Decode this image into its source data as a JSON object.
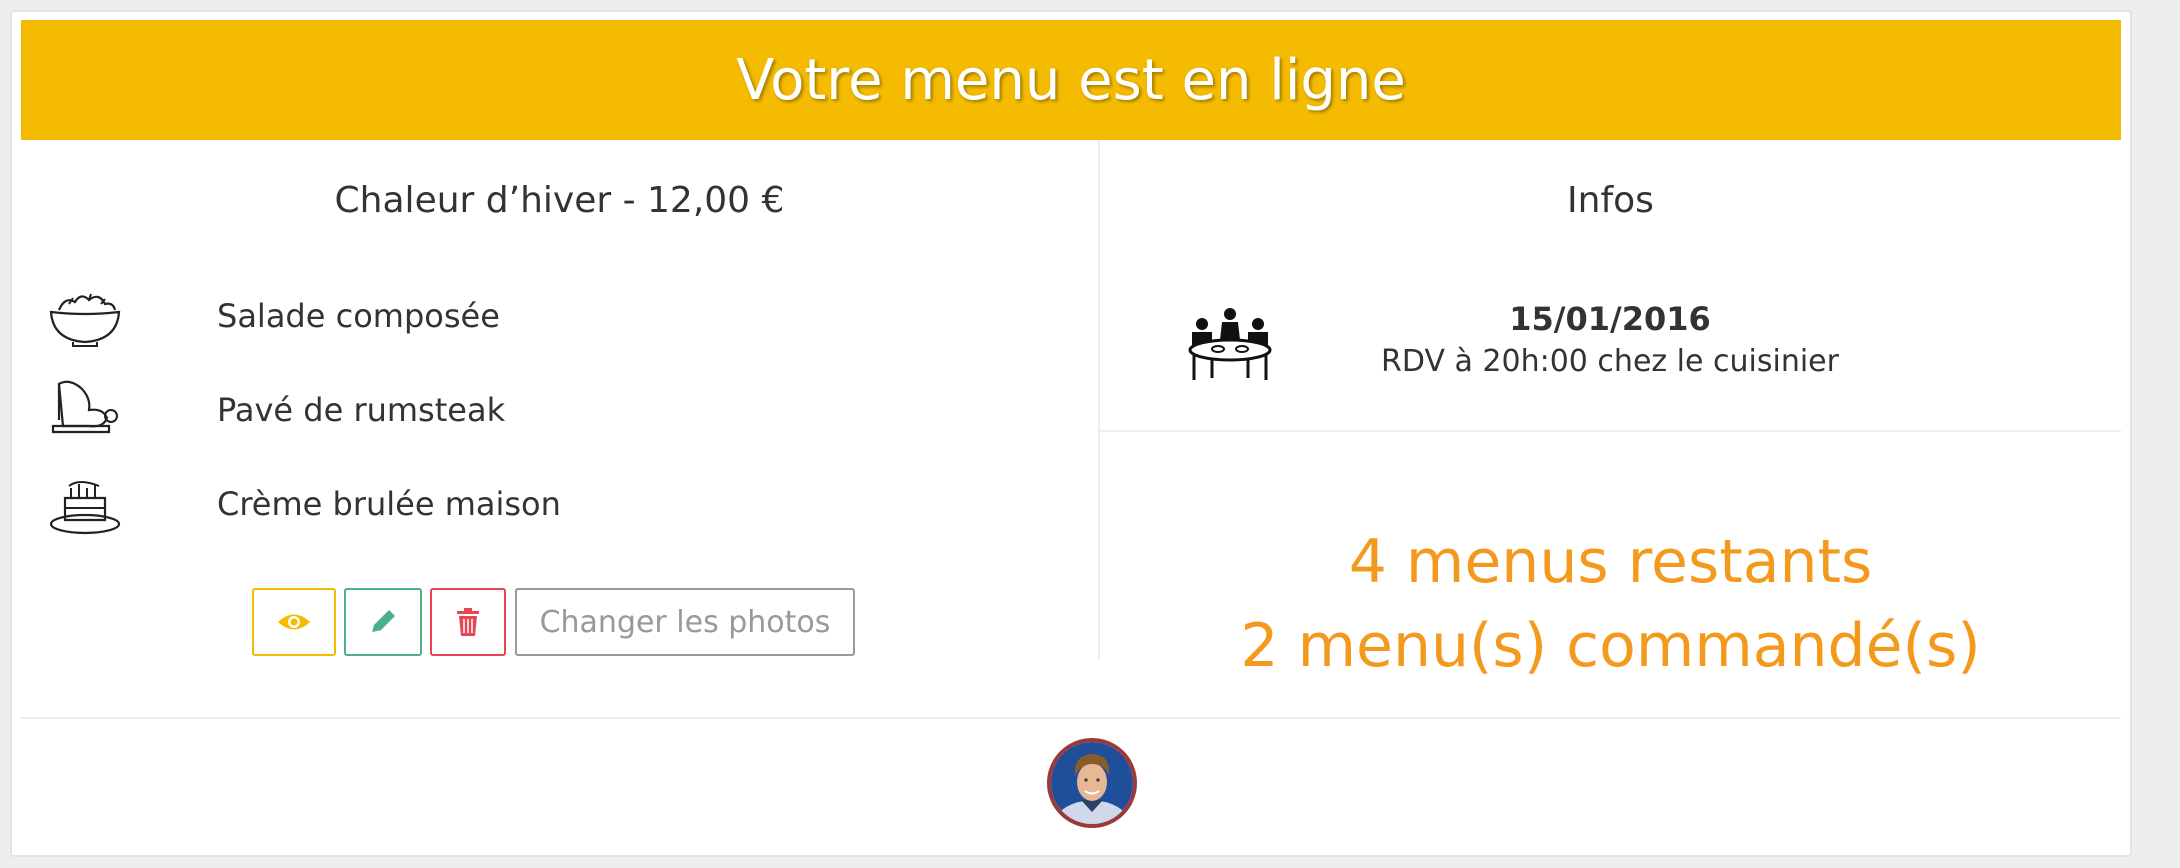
{
  "banner": {
    "title": "Votre menu est en ligne"
  },
  "menu": {
    "title": "Chaleur d’hiver - 12,00 €",
    "dishes": [
      {
        "icon": "salad-bowl-icon",
        "name": "Salade composée"
      },
      {
        "icon": "meat-icon",
        "name": "Pavé de rumsteak"
      },
      {
        "icon": "cake-icon",
        "name": "Crème brulée maison"
      }
    ]
  },
  "actions": {
    "view_icon": "eye-icon",
    "edit_icon": "pencil-icon",
    "delete_icon": "trash-icon",
    "photos_label": "Changer les photos"
  },
  "infos": {
    "title": "Infos",
    "date": "15/01/2016",
    "rdv": "RDV à 20h:00 chez le cuisinier"
  },
  "stats": {
    "remaining": "4 menus restants",
    "ordered": "2 menu(s) commandé(s)"
  },
  "colors": {
    "banner": "#f4bb00",
    "stats": "#f39a1e",
    "view": "#f4bb00",
    "edit": "#4caf87",
    "delete": "#e64552"
  }
}
